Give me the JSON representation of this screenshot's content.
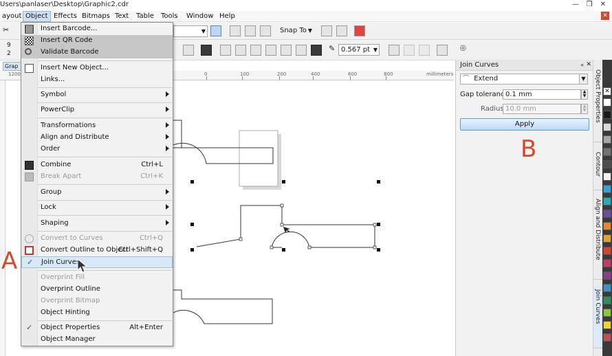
{
  "window": {
    "title": "Users\\panlaser\\Desktop\\Graphic2.cdr",
    "minimize": "—",
    "restore": "❐",
    "close": "✕"
  },
  "menubar": {
    "items": [
      "ayout",
      "Object",
      "Effects",
      "Bitmaps",
      "Text",
      "Table",
      "Tools",
      "Window",
      "Help"
    ],
    "close": "✕"
  },
  "toolbar": {
    "snap_to": "Snap To",
    "size_left_1": "9",
    "size_left_2": "2",
    "outline_width": "0.567 pt",
    "doc_tab": "Grap"
  },
  "ruler": {
    "labels": [
      "1200",
      "0",
      "100",
      "200",
      "400",
      "600",
      "800",
      "millimeters"
    ]
  },
  "object_menu": {
    "items": [
      {
        "label": "Insert Barcode...",
        "shortcut": "",
        "submenu": false,
        "disabled": false
      },
      {
        "label": "Insert QR Code",
        "shortcut": "",
        "submenu": false,
        "disabled": false
      },
      {
        "label": "Validate Barcode",
        "shortcut": "",
        "submenu": false,
        "disabled": false
      },
      {
        "label": "Insert New Object...",
        "shortcut": "",
        "submenu": false,
        "disabled": false
      },
      {
        "label": "Links...",
        "shortcut": "",
        "submenu": false,
        "disabled": false
      },
      {
        "label": "Symbol",
        "shortcut": "",
        "submenu": true,
        "disabled": false
      },
      {
        "label": "PowerClip",
        "shortcut": "",
        "submenu": true,
        "disabled": false
      },
      {
        "label": "Transformations",
        "shortcut": "",
        "submenu": true,
        "disabled": false
      },
      {
        "label": "Align and Distribute",
        "shortcut": "",
        "submenu": true,
        "disabled": false
      },
      {
        "label": "Order",
        "shortcut": "",
        "submenu": true,
        "disabled": false
      },
      {
        "label": "Combine",
        "shortcut": "Ctrl+L",
        "submenu": false,
        "disabled": false
      },
      {
        "label": "Break Apart",
        "shortcut": "Ctrl+K",
        "submenu": false,
        "disabled": true
      },
      {
        "label": "Group",
        "shortcut": "",
        "submenu": true,
        "disabled": false
      },
      {
        "label": "Lock",
        "shortcut": "",
        "submenu": true,
        "disabled": false
      },
      {
        "label": "Shaping",
        "shortcut": "",
        "submenu": true,
        "disabled": false
      },
      {
        "label": "Convert to Curves",
        "shortcut": "Ctrl+Q",
        "submenu": false,
        "disabled": true
      },
      {
        "label": "Convert Outline to Object",
        "shortcut": "Ctrl+Shift+Q",
        "submenu": false,
        "disabled": false
      },
      {
        "label": "Join Curves",
        "shortcut": "",
        "submenu": false,
        "disabled": false,
        "checked": true
      },
      {
        "label": "Overprint Fill",
        "shortcut": "",
        "submenu": false,
        "disabled": true
      },
      {
        "label": "Overprint Outline",
        "shortcut": "",
        "submenu": false,
        "disabled": false
      },
      {
        "label": "Overprint Bitmap",
        "shortcut": "",
        "submenu": false,
        "disabled": true
      },
      {
        "label": "Object Hinting",
        "shortcut": "",
        "submenu": false,
        "disabled": false
      },
      {
        "label": "Object Properties",
        "shortcut": "Alt+Enter",
        "submenu": false,
        "disabled": false,
        "checked": true
      },
      {
        "label": "Object Manager",
        "shortcut": "",
        "submenu": false,
        "disabled": false
      }
    ]
  },
  "join_curves": {
    "title": "Join Curves",
    "mode": "Extend",
    "gap_label": "Gap tolerance:",
    "gap_value": "0.1 mm",
    "radius_label": "Radius:",
    "radius_value": "10.0 mm",
    "apply_label": "Apply"
  },
  "side_tabs": [
    "Object Properties",
    "Contour",
    "Align and Distribute",
    "Join Curves"
  ],
  "annotations": {
    "a": "A",
    "b": "B"
  },
  "palette": [
    "#ffffff",
    "#1a1a1a",
    "#d9d9d9",
    "#a6a6a6",
    "#737373",
    "#4d4d4d",
    "#f2f2f2",
    "#33a3d6",
    "#2aa7b8",
    "#6a4f9e",
    "#e48a2e",
    "#e0a12d",
    "#d2452f",
    "#c23c6a",
    "#8a3f8c",
    "#3f8fc9",
    "#2e8f5e",
    "#8cc63f",
    "#f2d23a",
    "#c0504d"
  ]
}
